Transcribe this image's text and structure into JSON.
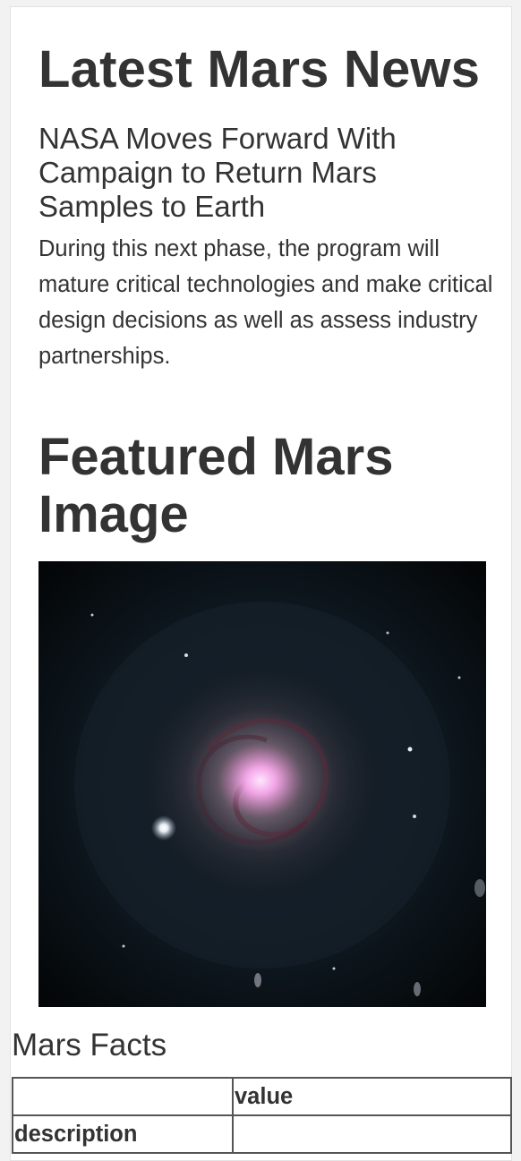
{
  "news": {
    "section_title": "Latest Mars News",
    "article_title": "NASA Moves Forward With Campaign to Return Mars Samples to Earth",
    "article_teaser": "During this next phase, the program will mature critical technologies and make critical design decisions as well as assess industry partnerships."
  },
  "featured": {
    "section_title": "Featured Mars Image",
    "image_icon": "spiral-galaxy-image"
  },
  "facts": {
    "section_title": "Mars Facts",
    "table": {
      "headers": [
        "",
        "value"
      ],
      "rows": [
        {
          "label": "description",
          "value": ""
        }
      ]
    }
  },
  "colors": {
    "text": "#333333",
    "page_background": "#ffffff",
    "outer_background": "#f2f2f2",
    "table_border": "#555555"
  }
}
